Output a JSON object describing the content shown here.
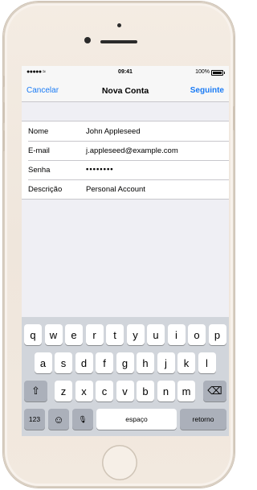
{
  "status_bar": {
    "signal": "●●●●● ≈",
    "time": "09:41",
    "battery": "100%"
  },
  "nav": {
    "cancel": "Cancelar",
    "title": "Nova Conta",
    "next": "Seguinte"
  },
  "form": {
    "rows": [
      {
        "label": "Nome",
        "value": "John Appleseed"
      },
      {
        "label": "E-mail",
        "value": "j.appleseed@example.com"
      },
      {
        "label": "Senha",
        "value": "••••••••"
      },
      {
        "label": "Descrição",
        "value": "Personal Account"
      }
    ]
  },
  "keyboard": {
    "row1": [
      "q",
      "w",
      "e",
      "r",
      "t",
      "y",
      "u",
      "i",
      "o",
      "p"
    ],
    "row2": [
      "a",
      "s",
      "d",
      "f",
      "g",
      "h",
      "j",
      "k",
      "l"
    ],
    "row3": [
      "z",
      "x",
      "c",
      "v",
      "b",
      "n",
      "m"
    ],
    "shift": "⇧",
    "delete": "⌫",
    "numbers": "123",
    "emoji": "☺",
    "mic": "🎙",
    "space": "espaço",
    "return": "retorno"
  },
  "colors": {
    "accent": "#1a7bf5",
    "background": "#efeff4",
    "keyboard": "#d1d5db"
  }
}
